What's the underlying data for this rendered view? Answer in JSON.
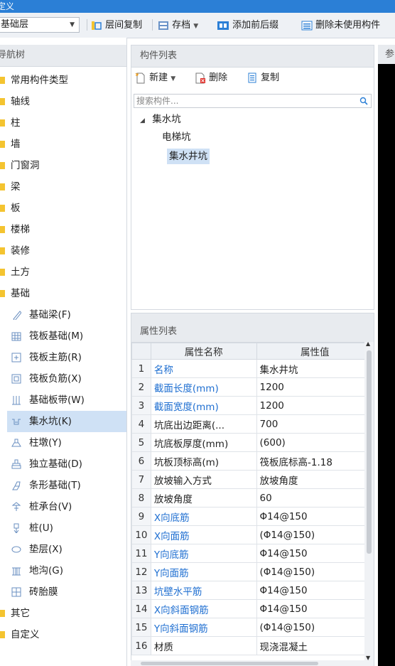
{
  "title": "定义",
  "toolbar": {
    "layer": "基础层",
    "copy_between_layers": "层间复制",
    "archive": "存档",
    "add_prefix_suffix": "添加前后缀",
    "delete_unused": "删除未使用构件"
  },
  "nav": {
    "header": "导航树",
    "items": [
      {
        "label": "常用构件类型"
      },
      {
        "label": "轴线"
      },
      {
        "label": "柱"
      },
      {
        "label": "墙"
      },
      {
        "label": "门窗洞"
      },
      {
        "label": "梁"
      },
      {
        "label": "板"
      },
      {
        "label": "楼梯"
      },
      {
        "label": "装修"
      },
      {
        "label": "土方"
      },
      {
        "label": "基础"
      }
    ],
    "sub_items": [
      {
        "label": "基础梁(F)",
        "icon": "beam-icon"
      },
      {
        "label": "筏板基础(M)",
        "icon": "raft-foundation-icon"
      },
      {
        "label": "筏板主筋(R)",
        "icon": "raft-main-rebar-icon"
      },
      {
        "label": "筏板负筋(X)",
        "icon": "raft-negative-rebar-icon"
      },
      {
        "label": "基础板带(W)",
        "icon": "foundation-strip-icon"
      },
      {
        "label": "集水坑(K)",
        "icon": "sump-pit-icon",
        "selected": true
      },
      {
        "label": "柱墩(Y)",
        "icon": "column-pier-icon"
      },
      {
        "label": "独立基础(D)",
        "icon": "isolated-footing-icon"
      },
      {
        "label": "条形基础(T)",
        "icon": "strip-footing-icon"
      },
      {
        "label": "桩承台(V)",
        "icon": "pile-cap-icon"
      },
      {
        "label": "桩(U)",
        "icon": "pile-icon"
      },
      {
        "label": "垫层(X)",
        "icon": "cushion-icon"
      },
      {
        "label": "地沟(G)",
        "icon": "trench-icon"
      },
      {
        "label": "砖胎膜",
        "icon": "brick-mold-icon"
      }
    ],
    "items_after": [
      {
        "label": "其它"
      },
      {
        "label": "自定义"
      }
    ]
  },
  "components": {
    "header": "构件列表",
    "new": "新建",
    "delete": "删除",
    "copy": "复制",
    "search_placeholder": "搜索构件...",
    "tree": {
      "parent": "集水坑",
      "children": [
        "电梯坑",
        "集水井坑"
      ],
      "selected": "集水井坑"
    }
  },
  "properties": {
    "header": "属性列表",
    "col_name": "属性名称",
    "col_value": "属性值",
    "rows": [
      {
        "n": "1",
        "name": "名称",
        "value": "集水井坑",
        "blue": true
      },
      {
        "n": "2",
        "name": "截面长度(mm)",
        "value": "1200",
        "blue": true
      },
      {
        "n": "3",
        "name": "截面宽度(mm)",
        "value": "1200",
        "blue": true
      },
      {
        "n": "4",
        "name": "坑底出边距离(...",
        "value": "700",
        "blue": false
      },
      {
        "n": "5",
        "name": "坑底板厚度(mm)",
        "value": "(600)",
        "blue": false
      },
      {
        "n": "6",
        "name": "坑板顶标高(m)",
        "value": "筏板底标高-1.18",
        "blue": false
      },
      {
        "n": "7",
        "name": "放坡输入方式",
        "value": "放坡角度",
        "blue": false
      },
      {
        "n": "8",
        "name": "放坡角度",
        "value": "60",
        "blue": false
      },
      {
        "n": "9",
        "name": "X向底筋",
        "value": "Φ14@150",
        "blue": true
      },
      {
        "n": "10",
        "name": "X向面筋",
        "value": "(Φ14@150)",
        "blue": true
      },
      {
        "n": "11",
        "name": "Y向底筋",
        "value": "Φ14@150",
        "blue": true
      },
      {
        "n": "12",
        "name": "Y向面筋",
        "value": "(Φ14@150)",
        "blue": true
      },
      {
        "n": "13",
        "name": "坑壁水平筋",
        "value": "Φ14@150",
        "blue": true
      },
      {
        "n": "14",
        "name": "X向斜面钢筋",
        "value": "Φ14@150",
        "blue": true
      },
      {
        "n": "15",
        "name": "Y向斜面钢筋",
        "value": "(Φ14@150)",
        "blue": true
      },
      {
        "n": "16",
        "name": "材质",
        "value": "现浇混凝土",
        "blue": false
      }
    ]
  },
  "ref_header": "参"
}
